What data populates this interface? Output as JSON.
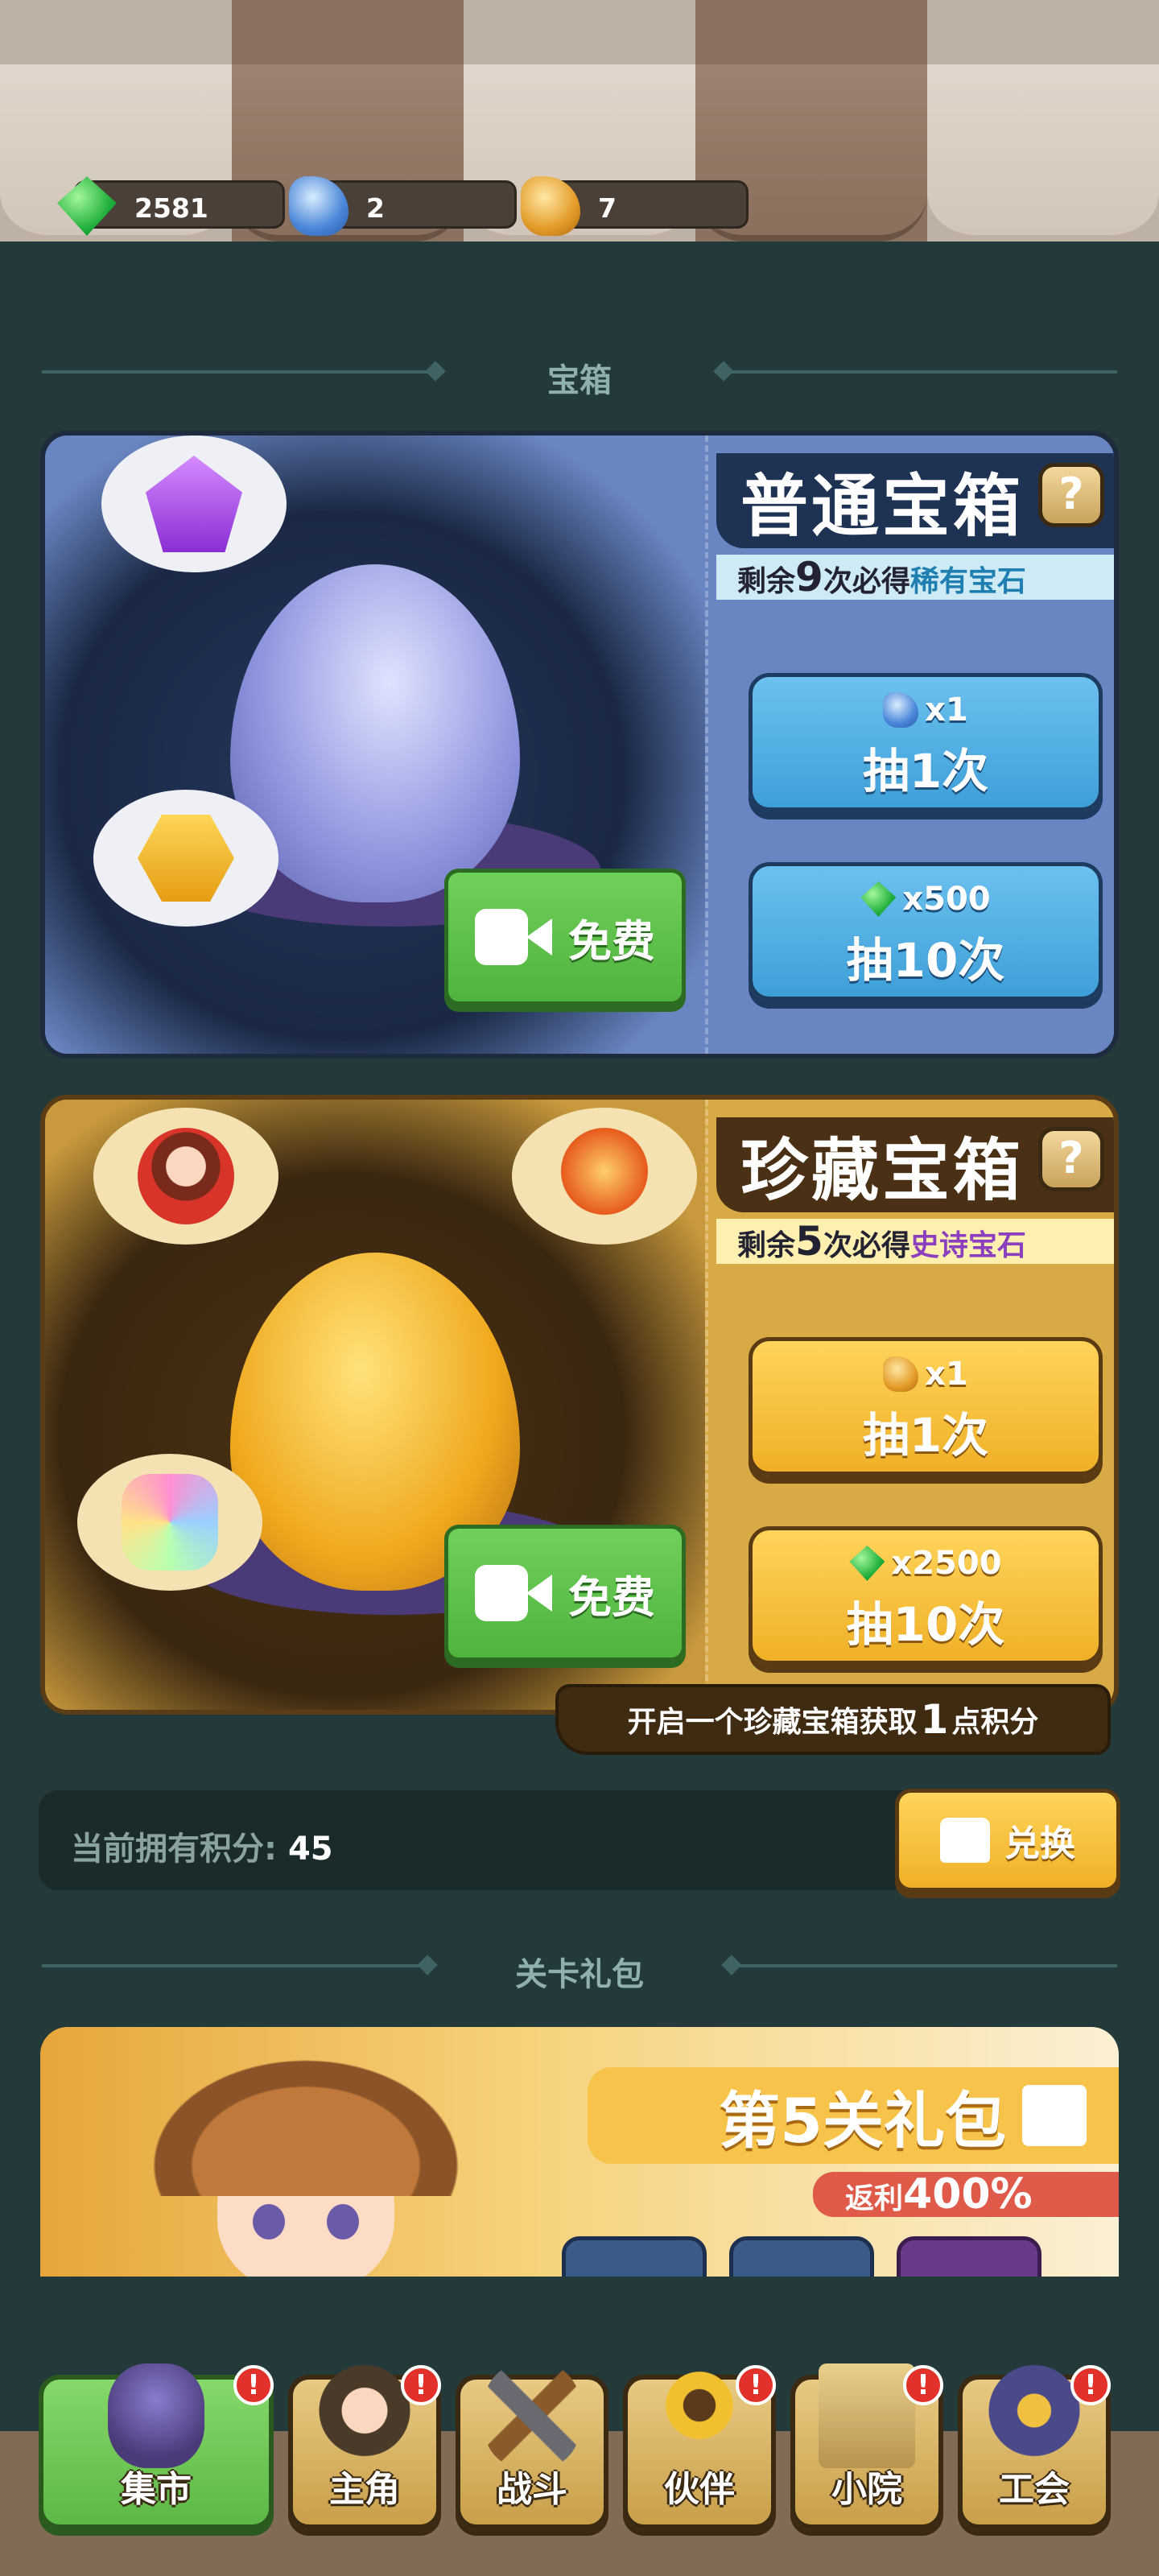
{
  "resources": [
    {
      "icon": "green-gem-icon",
      "value": "2581"
    },
    {
      "icon": "blue-hammer-icon",
      "value": "2"
    },
    {
      "icon": "gold-hammer-icon",
      "value": "7"
    }
  ],
  "chest_section_title": "宝箱",
  "normal_chest": {
    "title": "普通宝箱",
    "help": "?",
    "pity_prefix": "剩余",
    "pity_count": "9",
    "pity_middle": "次必得",
    "pity_reward": "稀有宝石",
    "free_label": "免费",
    "draw1_cost": "x1",
    "draw1_label": "抽1次",
    "draw10_cost": "x500",
    "draw10_label": "抽10次"
  },
  "treasure_chest": {
    "title": "珍藏宝箱",
    "help": "?",
    "pity_prefix": "剩余",
    "pity_count": "5",
    "pity_middle": "次必得",
    "pity_reward": "史诗宝石",
    "free_label": "免费",
    "draw1_cost": "x1",
    "draw1_label": "抽1次",
    "draw10_cost": "x2500",
    "draw10_label": "抽10次",
    "points_note_prefix": "开启一个珍藏宝箱获取",
    "points_note_num": "1",
    "points_note_suffix": "点积分"
  },
  "points": {
    "label": "当前拥有积分:",
    "value": "45",
    "exchange_label": "兑换"
  },
  "gift_section_title": "关卡礼包",
  "gift": {
    "title": "第5关礼包",
    "rebate_label": "返利",
    "rebate_value": "400%"
  },
  "nav": [
    {
      "label": "集市",
      "badge": "!",
      "icon": "mushroom-house-icon"
    },
    {
      "label": "主角",
      "badge": "!",
      "icon": "hero-icon"
    },
    {
      "label": "战斗",
      "badge": "",
      "icon": "crossed-tools-icon"
    },
    {
      "label": "伙伴",
      "badge": "!",
      "icon": "sunflower-icon"
    },
    {
      "label": "小院",
      "badge": "!",
      "icon": "castle-icon"
    },
    {
      "label": "工会",
      "badge": "!",
      "icon": "guild-shield-icon"
    }
  ],
  "colors": {
    "accent_green": "#5cb845",
    "accent_gold": "#f0b027",
    "accent_blue": "#3e9fd8",
    "badge_red": "#e2312a"
  }
}
